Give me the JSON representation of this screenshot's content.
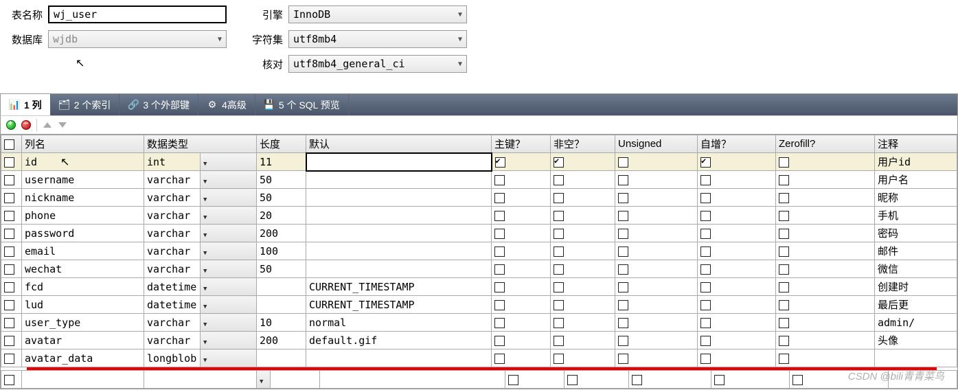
{
  "form": {
    "table_name_label": "表名称",
    "table_name_value": "wj_user",
    "database_label": "数据库",
    "database_value": "wjdb",
    "engine_label": "引擎",
    "engine_value": "InnoDB",
    "charset_label": "字符集",
    "charset_value": "utf8mb4",
    "collation_label": "核对",
    "collation_value": "utf8mb4_general_ci"
  },
  "tabs": [
    {
      "label": "1 列",
      "active": true
    },
    {
      "label": "2 个索引",
      "active": false
    },
    {
      "label": "3 个外部键",
      "active": false
    },
    {
      "label": "4高级",
      "active": false
    },
    {
      "label": "5 个 SQL 预览",
      "active": false
    }
  ],
  "headers": {
    "name": "列名",
    "type": "数据类型",
    "length": "长度",
    "default": "默认",
    "pk": "主键？",
    "nn": "非空？",
    "unsigned": "Unsigned",
    "ai": "自增？",
    "zf": "Zerofill?",
    "comment": "注释"
  },
  "columns": [
    {
      "name": "id",
      "type": "int",
      "len": "11",
      "def": "",
      "pk": true,
      "nn": true,
      "un": false,
      "ai": true,
      "zf": false,
      "comment": "用户id",
      "sel": true
    },
    {
      "name": "username",
      "type": "varchar",
      "len": "50",
      "def": "",
      "pk": false,
      "nn": false,
      "un": false,
      "ai": false,
      "zf": false,
      "comment": "用户名"
    },
    {
      "name": "nickname",
      "type": "varchar",
      "len": "50",
      "def": "",
      "pk": false,
      "nn": false,
      "un": false,
      "ai": false,
      "zf": false,
      "comment": "昵称"
    },
    {
      "name": "phone",
      "type": "varchar",
      "len": "20",
      "def": "",
      "pk": false,
      "nn": false,
      "un": false,
      "ai": false,
      "zf": false,
      "comment": "手机"
    },
    {
      "name": "password",
      "type": "varchar",
      "len": "200",
      "def": "",
      "pk": false,
      "nn": false,
      "un": false,
      "ai": false,
      "zf": false,
      "comment": "密码"
    },
    {
      "name": "email",
      "type": "varchar",
      "len": "100",
      "def": "",
      "pk": false,
      "nn": false,
      "un": false,
      "ai": false,
      "zf": false,
      "comment": "邮件"
    },
    {
      "name": "wechat",
      "type": "varchar",
      "len": "50",
      "def": "",
      "pk": false,
      "nn": false,
      "un": false,
      "ai": false,
      "zf": false,
      "comment": "微信"
    },
    {
      "name": "fcd",
      "type": "datetime",
      "len": "",
      "def": "CURRENT_TIMESTAMP",
      "pk": false,
      "nn": false,
      "un": false,
      "ai": false,
      "zf": false,
      "comment": "创建时"
    },
    {
      "name": "lud",
      "type": "datetime",
      "len": "",
      "def": "CURRENT_TIMESTAMP",
      "pk": false,
      "nn": false,
      "un": false,
      "ai": false,
      "zf": false,
      "comment": "最后更"
    },
    {
      "name": "user_type",
      "type": "varchar",
      "len": "10",
      "def": "normal",
      "pk": false,
      "nn": false,
      "un": false,
      "ai": false,
      "zf": false,
      "comment": "admin/"
    },
    {
      "name": "avatar",
      "type": "varchar",
      "len": "200",
      "def": "default.gif",
      "pk": false,
      "nn": false,
      "un": false,
      "ai": false,
      "zf": false,
      "comment": "头像"
    },
    {
      "name": "avatar_data",
      "type": "longblob",
      "len": "",
      "def": "",
      "pk": false,
      "nn": false,
      "un": false,
      "ai": false,
      "zf": false,
      "comment": ""
    }
  ],
  "watermark": "CSDN @bili青青菜鸟"
}
